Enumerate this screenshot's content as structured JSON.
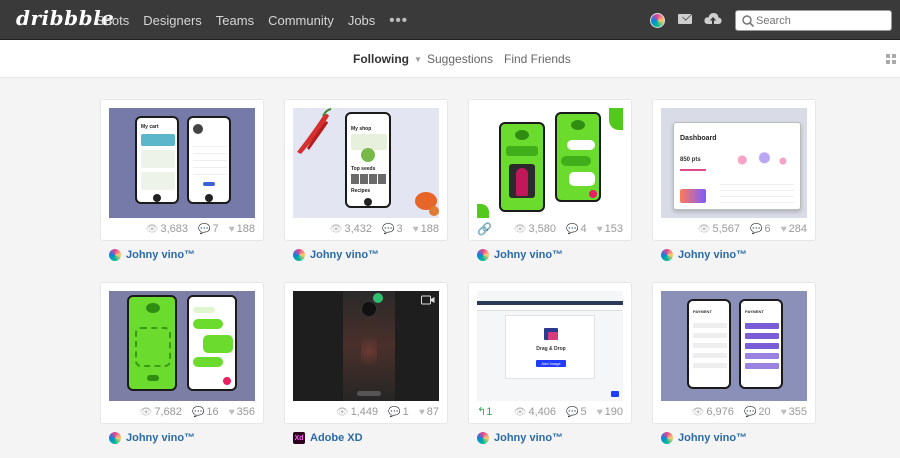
{
  "header": {
    "logo": "dribbble",
    "nav": [
      "Shots",
      "Designers",
      "Teams",
      "Community",
      "Jobs"
    ],
    "more": "•••",
    "search_placeholder": "Search"
  },
  "subnav": {
    "tabs": [
      "Following",
      "Suggestions",
      "Find Friends"
    ],
    "active": "Following"
  },
  "shots": [
    {
      "views": "3,683",
      "comments": "7",
      "likes": "188",
      "author": "Johny vino™",
      "thumb": {
        "title": "My cart",
        "title2": "",
        "bg": "#767aa8"
      }
    },
    {
      "views": "3,432",
      "comments": "3",
      "likes": "188",
      "author": "Johny vino™",
      "thumb": {
        "title": "My shop",
        "title2": "Top seeds",
        "title3": "Recipes",
        "bg": "#e4e5f2"
      }
    },
    {
      "views": "3,580",
      "comments": "4",
      "likes": "153",
      "author": "Johny vino™",
      "thumb": {
        "bg": "#ffffff"
      }
    },
    {
      "views": "5,567",
      "comments": "6",
      "likes": "284",
      "author": "Johny vino™",
      "thumb": {
        "title": "Dashboard",
        "value": "850 pts",
        "bg": "#d9dbe6"
      }
    },
    {
      "views": "7,682",
      "comments": "16",
      "likes": "356",
      "author": "Johny vino™",
      "thumb": {
        "bg": "#7d7ea5"
      }
    },
    {
      "views": "1,449",
      "comments": "1",
      "likes": "87",
      "author": "Adobe XD",
      "thumb": {
        "bg": "#1e1e1e"
      }
    },
    {
      "views": "4,406",
      "comments": "5",
      "likes": "190",
      "rebounds": "1",
      "author": "Johny vino™",
      "thumb": {
        "heading": "Drag & Drop",
        "button": "Add Image",
        "bg": "#f5f6f8"
      }
    },
    {
      "views": "6,976",
      "comments": "20",
      "likes": "355",
      "author": "Johny vino™",
      "thumb": {
        "title": "PAYMENT",
        "title2": "PAYMENT",
        "bg": "#8a90b8"
      }
    }
  ],
  "colors": {
    "header_bg": "#3a3a3a",
    "author_link": "#2b6aa6",
    "lime": "#6bdb2e"
  }
}
